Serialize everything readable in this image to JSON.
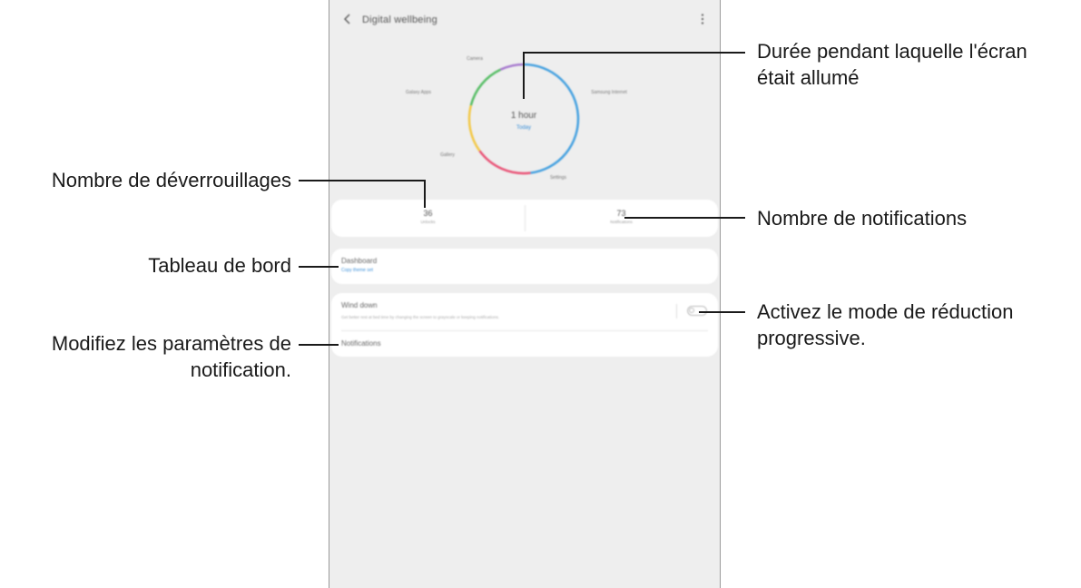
{
  "screen": {
    "app_title": "Digital wellbeing",
    "donut": {
      "center_value": "1 hour",
      "center_sub": "Today",
      "segments": [
        {
          "label": "Samsung Internet",
          "color": "#4aa3e0",
          "share": 0.48
        },
        {
          "label": "Settings",
          "color": "#e9587a",
          "share": 0.17
        },
        {
          "label": "Gallery",
          "color": "#f2c94c",
          "share": 0.14
        },
        {
          "label": "Galaxy Apps",
          "color": "#5cbf6a",
          "share": 0.14
        },
        {
          "label": "Camera",
          "color": "#a87ccf",
          "share": 0.07
        }
      ]
    },
    "stats": {
      "unlocks_value": "36",
      "unlocks_label": "Unlocks",
      "notifications_value": "73",
      "notifications_label": "Notifications"
    },
    "dashboard": {
      "title": "Dashboard",
      "subtitle": "Copy theme set"
    },
    "wind_down": {
      "title": "Wind down",
      "description": "Get better rest at bed time by changing the screen to grayscale or keeping notifications."
    },
    "notifications_row": "Notifications"
  },
  "callouts": {
    "screen_time": [
      "Durée pendant laquelle l'écran",
      "était allumé"
    ],
    "unlocks": "Nombre de déverrouillages",
    "notifications_count": "Nombre de notifications",
    "dashboard": "Tableau de bord",
    "wind_down": [
      "Activez le mode de réduction",
      "progressive."
    ],
    "notification_settings": [
      "Modifiez les paramètres de",
      "notification."
    ]
  }
}
